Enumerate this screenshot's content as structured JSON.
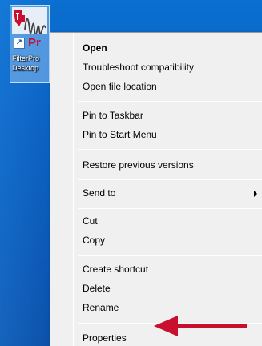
{
  "desktop": {
    "icon": {
      "name": "ti-filterpro-icon",
      "short_text": "Pr",
      "label_line1": "FilterPro",
      "label_line2": "Desktop"
    }
  },
  "context_menu": {
    "items": [
      {
        "label": "Open",
        "bold": true
      },
      {
        "label": "Troubleshoot compatibility"
      },
      {
        "label": "Open file location"
      },
      {
        "label": "Pin to Taskbar"
      },
      {
        "label": "Pin to Start Menu"
      },
      {
        "label": "Restore previous versions"
      },
      {
        "label": "Send to",
        "submenu": true
      },
      {
        "label": "Cut"
      },
      {
        "label": "Copy"
      },
      {
        "label": "Create shortcut"
      },
      {
        "label": "Delete"
      },
      {
        "label": "Rename"
      },
      {
        "label": "Properties"
      }
    ]
  },
  "annotation": {
    "arrow_color": "#c8102e"
  }
}
